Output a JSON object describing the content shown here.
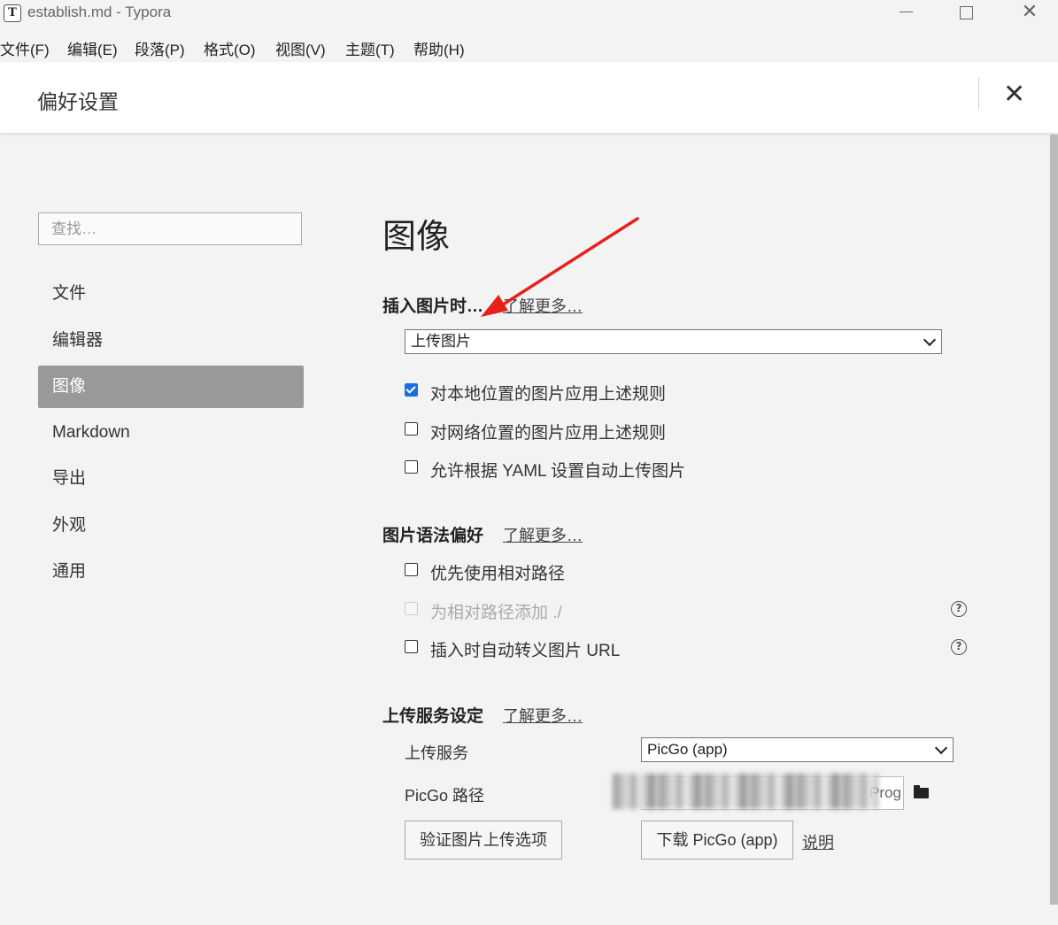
{
  "window": {
    "title": "establish.md - Typora",
    "app_icon": "T"
  },
  "menu": [
    "文件(F)",
    "编辑(E)",
    "段落(P)",
    "格式(O)",
    "视图(V)",
    "主题(T)",
    "帮助(H)"
  ],
  "preferences": {
    "title": "偏好设置"
  },
  "sidebar": {
    "search_placeholder": "查找…",
    "items": [
      {
        "label": "文件"
      },
      {
        "label": "编辑器"
      },
      {
        "label": "图像",
        "active": true
      },
      {
        "label": "Markdown"
      },
      {
        "label": "导出"
      },
      {
        "label": "外观"
      },
      {
        "label": "通用"
      }
    ]
  },
  "main": {
    "heading": "图像",
    "insert_section": {
      "title": "插入图片时…",
      "learn_more": "了解更多…",
      "selected_action": "上传图片",
      "options": [
        {
          "label": "对本地位置的图片应用上述规则",
          "checked": true
        },
        {
          "label": "对网络位置的图片应用上述规则",
          "checked": false
        },
        {
          "label": "允许根据 YAML 设置自动上传图片",
          "checked": false
        }
      ]
    },
    "syntax_section": {
      "title": "图片语法偏好",
      "learn_more": "了解更多…",
      "options": [
        {
          "label": "优先使用相对路径",
          "checked": false
        },
        {
          "label": "为相对路径添加 ./",
          "checked": false,
          "disabled": true
        },
        {
          "label": "插入时自动转义图片 URL",
          "checked": false
        }
      ],
      "help_icon": "?"
    },
    "upload_section": {
      "title": "上传服务设定",
      "learn_more": "了解更多…",
      "service_label": "上传服务",
      "service_value": "PicGo (app)",
      "path_label": "PicGo 路径",
      "path_value": "Prog",
      "verify_button": "验证图片上传选项",
      "download_button": "下载 PicGo (app)",
      "explain_link": "说明"
    }
  },
  "annotation": {
    "arrow_color": "#e8201c"
  }
}
